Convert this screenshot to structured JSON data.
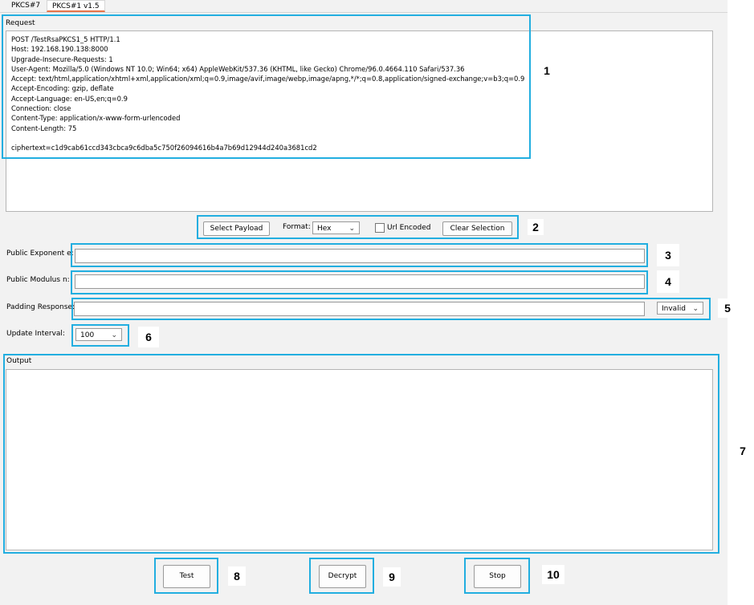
{
  "tabs": [
    {
      "label": "PKCS#7"
    },
    {
      "label": "PKCS#1 v1.5"
    }
  ],
  "request": {
    "label": "Request",
    "lines": [
      "POST /TestRsaPKCS1_5 HTTP/1.1",
      "Host: 192.168.190.138:8000",
      "Upgrade-Insecure-Requests: 1",
      "User-Agent: Mozilla/5.0 (Windows NT 10.0; Win64; x64) AppleWebKit/537.36 (KHTML, like Gecko) Chrome/96.0.4664.110 Safari/537.36",
      "Accept: text/html,application/xhtml+xml,application/xml;q=0.9,image/avif,image/webp,image/apng,*/*;q=0.8,application/signed-exchange;v=b3;q=0.9",
      "Accept-Encoding: gzip, deflate",
      "Accept-Language: en-US,en;q=0.9",
      "Connection: close",
      "Content-Type: application/x-www-form-urlencoded",
      "Content-Length: 75",
      "",
      "ciphertext=c1d9cab61ccd343cbca9c6dba5c750f26094616b4a7b69d12944d240a3681cd2"
    ]
  },
  "toolbar": {
    "select_payload": "Select Payload",
    "format_label": "Format:",
    "format_value": "Hex",
    "url_encoded": "Url Encoded",
    "clear_selection": "Clear Selection"
  },
  "fields": {
    "public_exponent": "Public Exponent e:",
    "public_modulus": "Public Modulus n:",
    "padding_response": "Padding Response:",
    "padding_value": "Invalid",
    "update_interval": "Update Interval:",
    "update_interval_value": "100"
  },
  "output": {
    "label": "Output"
  },
  "buttons": {
    "test": "Test",
    "decrypt": "Decrypt",
    "stop": "Stop"
  },
  "annotations": [
    "1",
    "2",
    "3",
    "4",
    "5",
    "6",
    "7",
    "8",
    "9",
    "10"
  ],
  "colors": {
    "highlight": "#22aee0",
    "tab_accent": "#e8744a"
  }
}
